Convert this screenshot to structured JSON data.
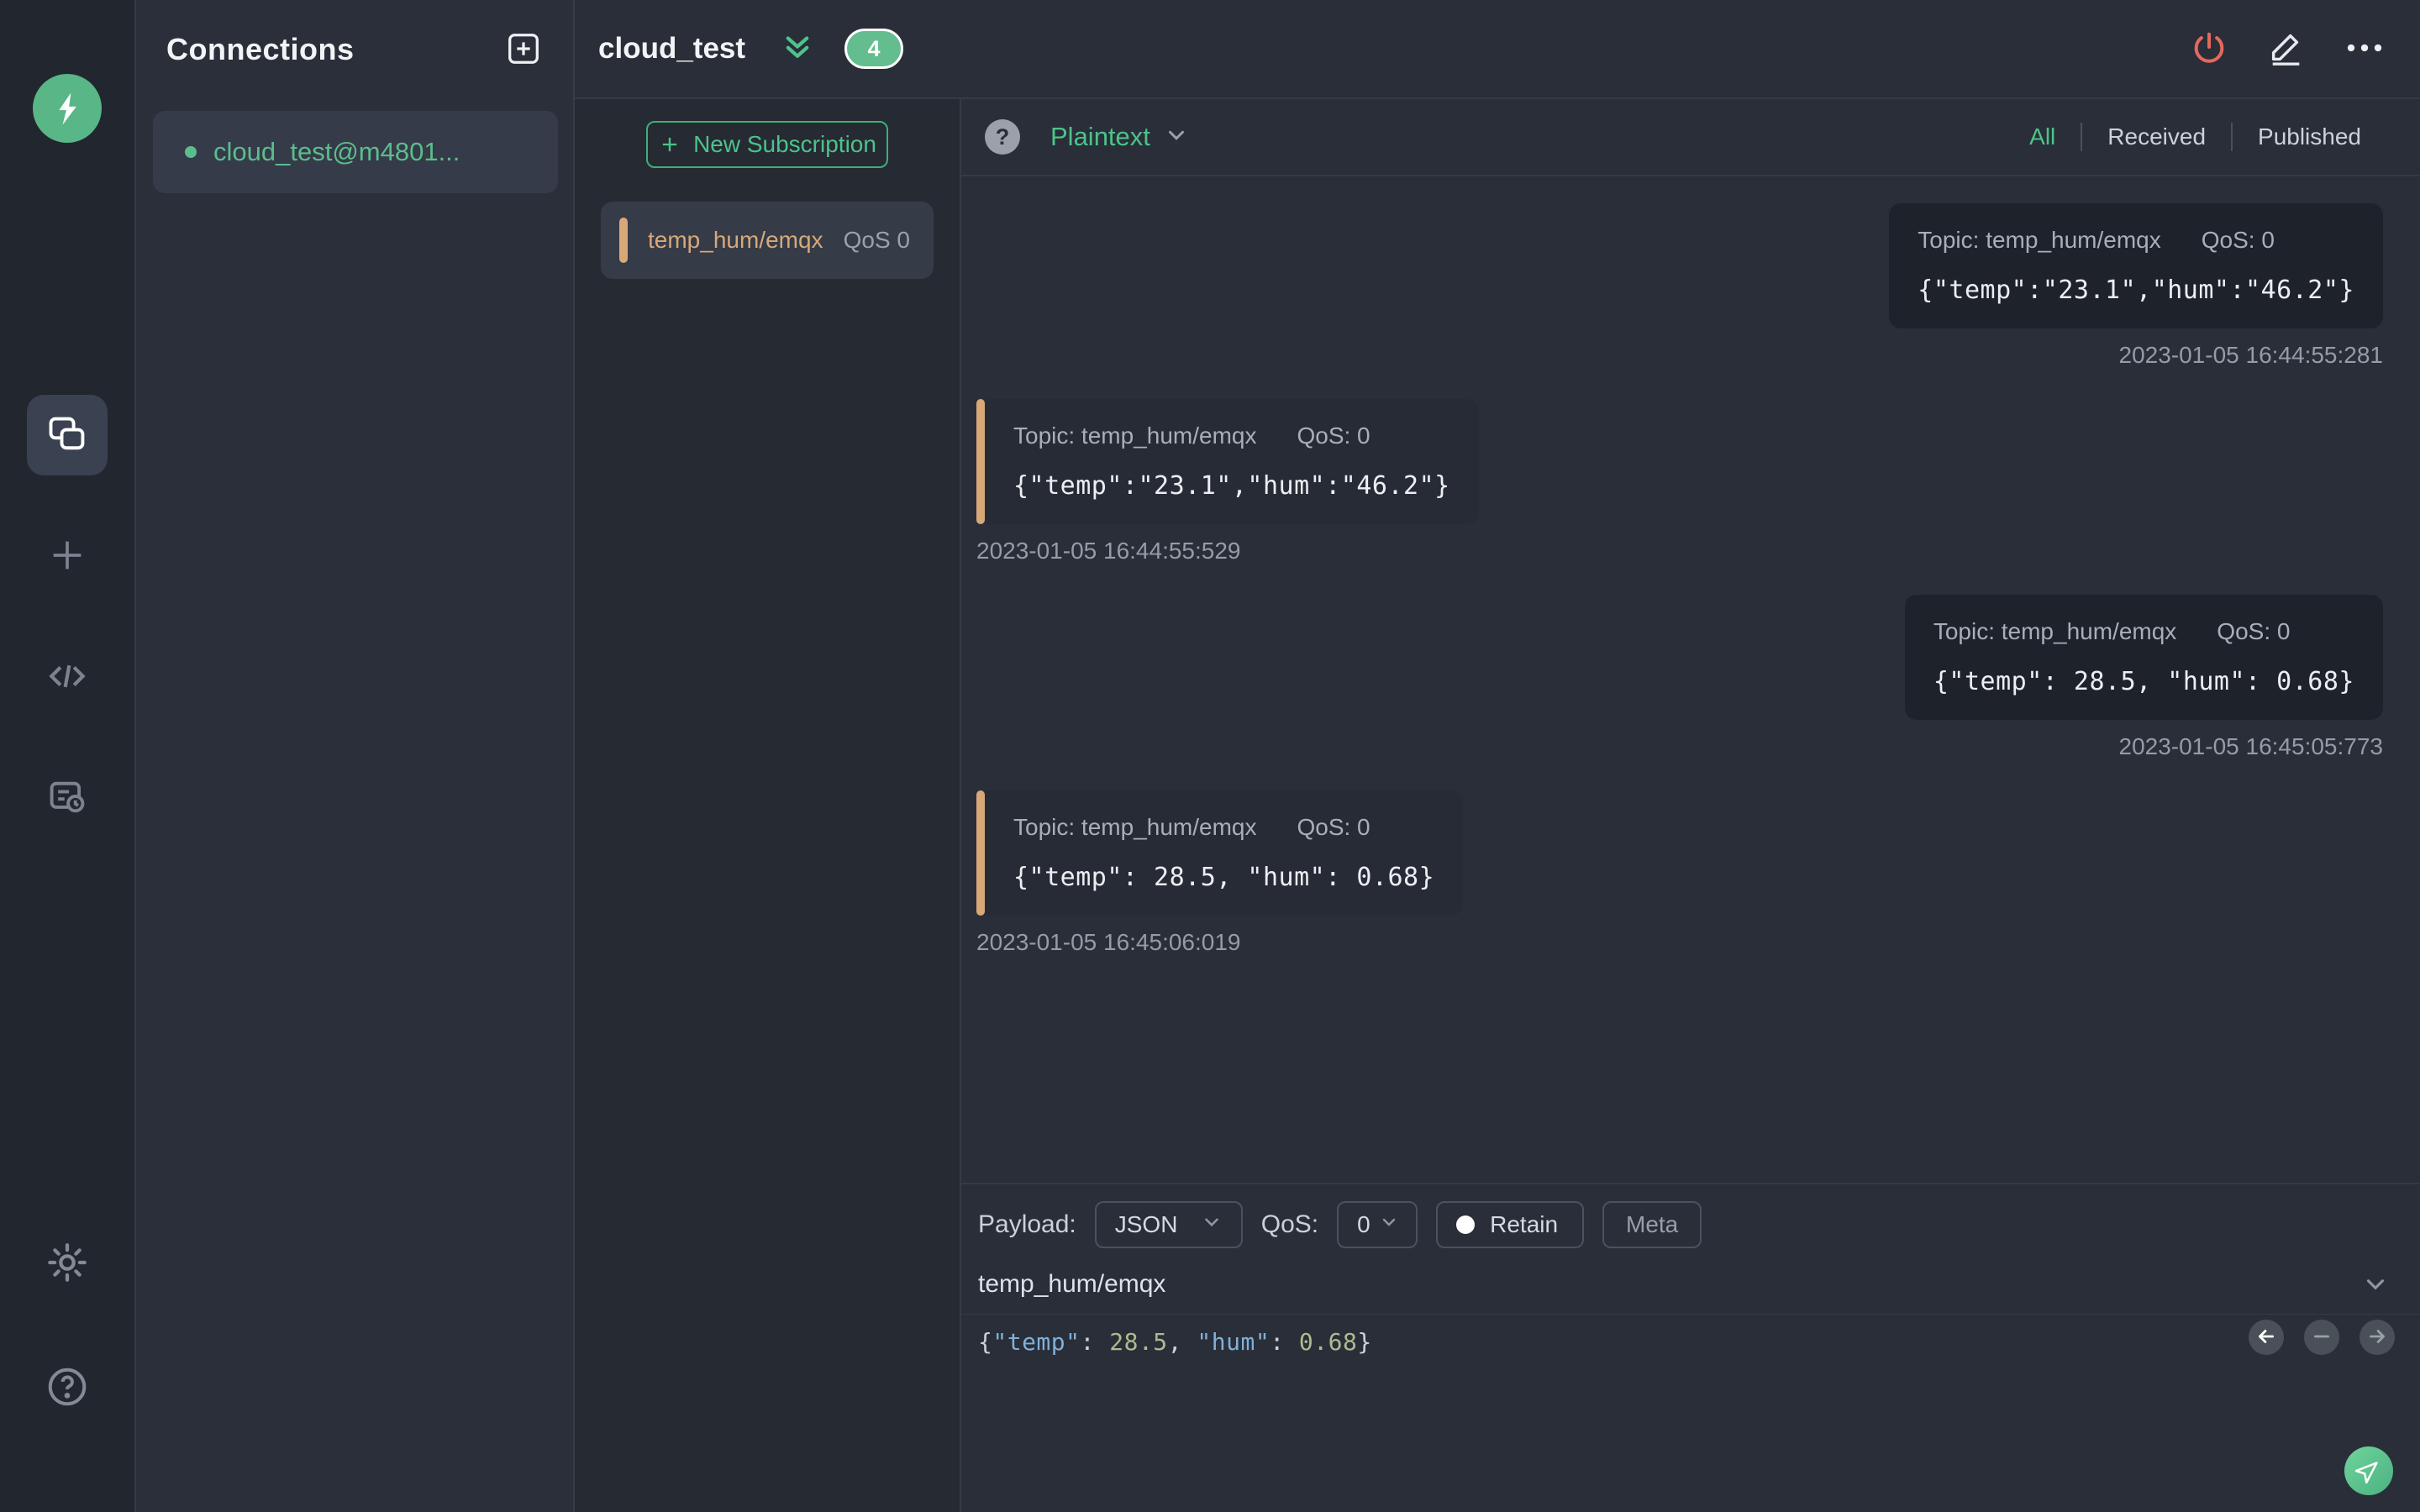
{
  "colors": {
    "accent_green": "#4cc38a",
    "badge_green": "#63bd8f",
    "disconnect_red": "#e4695e",
    "subscription_tan": "#d8a878",
    "panel_dark": "#2a2e38",
    "card_dark": "#1e222b"
  },
  "rail": {
    "icons": [
      "mqttx-logo-icon",
      "connections-icon",
      "new-connection-plus-icon",
      "script-icon",
      "log-icon",
      "settings-gear-icon",
      "help-icon"
    ]
  },
  "connections_panel": {
    "title": "Connections",
    "add_icon": "add-connection-icon",
    "items": [
      {
        "label": "cloud_test@m4801...",
        "status": "connected"
      }
    ]
  },
  "header": {
    "title": "cloud_test",
    "badge_count": "4",
    "icons": [
      "collapse-double-chevron-icon",
      "disconnect-power-icon",
      "edit-pencil-icon",
      "more-ellipsis-icon"
    ]
  },
  "subscriptions": {
    "new_button_label": "New Subscription",
    "items": [
      {
        "topic": "temp_hum/emqx",
        "qos": "QoS 0"
      }
    ]
  },
  "toolbar": {
    "help_icon": "?",
    "format_value": "Plaintext",
    "filters": [
      {
        "label": "All",
        "active": true
      },
      {
        "label": "Received",
        "active": false
      },
      {
        "label": "Published",
        "active": false
      }
    ]
  },
  "messages": [
    {
      "direction": "published",
      "topic_label": "Topic: temp_hum/emqx",
      "qos_label": "QoS: 0",
      "payload": "{\"temp\":\"23.1\",\"hum\":\"46.2\"}",
      "timestamp": "2023-01-05 16:44:55:281"
    },
    {
      "direction": "received",
      "topic_label": "Topic: temp_hum/emqx",
      "qos_label": "QoS: 0",
      "payload": "{\"temp\":\"23.1\",\"hum\":\"46.2\"}",
      "timestamp": "2023-01-05 16:44:55:529"
    },
    {
      "direction": "published",
      "topic_label": "Topic: temp_hum/emqx",
      "qos_label": "QoS: 0",
      "payload": "{\"temp\": 28.5, \"hum\": 0.68}",
      "timestamp": "2023-01-05 16:45:05:773"
    },
    {
      "direction": "received",
      "topic_label": "Topic: temp_hum/emqx",
      "qos_label": "QoS: 0",
      "payload": "{\"temp\": 28.5, \"hum\": 0.68}",
      "timestamp": "2023-01-05 16:45:06:019"
    }
  ],
  "publish": {
    "payload_label": "Payload:",
    "format_value": "JSON",
    "qos_label": "QoS:",
    "qos_value": "0",
    "retain_label": "Retain",
    "meta_label": "Meta",
    "topic_value": "temp_hum/emqx",
    "editor": {
      "open": "{",
      "key1": "\"temp\"",
      "colon1": ": ",
      "num1": "28.5",
      "comma": ", ",
      "key2": "\"hum\"",
      "colon2": ": ",
      "num2": "0.68",
      "close": "}"
    }
  }
}
